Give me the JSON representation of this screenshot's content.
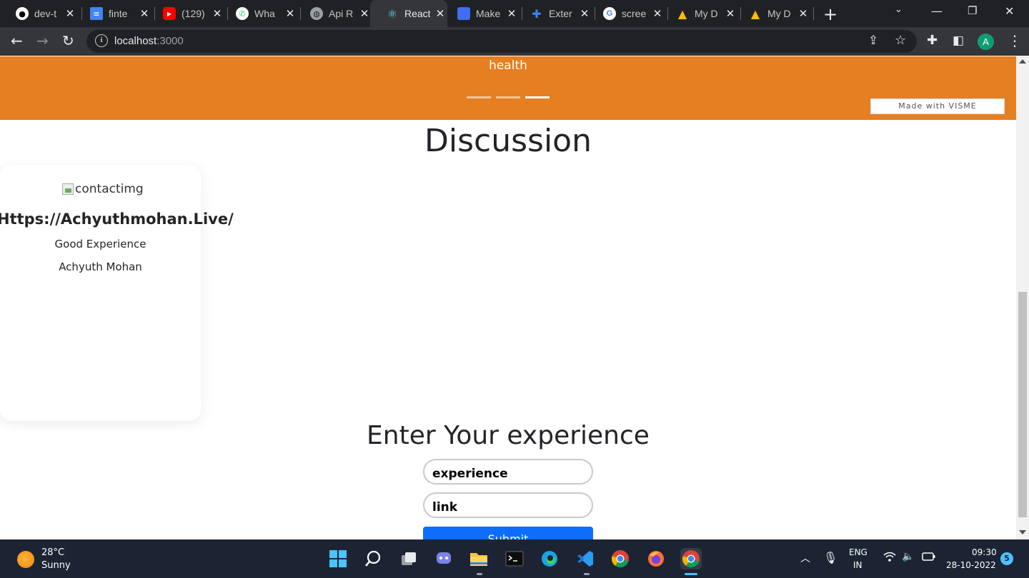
{
  "browser": {
    "tabs": [
      {
        "label": "dev-t",
        "icon": "github-icon",
        "color": "#ffffff"
      },
      {
        "label": "finte",
        "icon": "docs-icon",
        "color": "#4285f4"
      },
      {
        "label": "(129)",
        "icon": "youtube-icon",
        "color": "#ff0000"
      },
      {
        "label": "Wha",
        "icon": "whatsapp-icon",
        "color": "#25d366"
      },
      {
        "label": "Api R",
        "icon": "globe-icon",
        "color": "#9aa0a6"
      },
      {
        "label": "React",
        "icon": "react-icon",
        "color": "#61dafb",
        "active": true
      },
      {
        "label": "Make",
        "icon": "docs-blue-icon",
        "color": "#3f6ef3"
      },
      {
        "label": "Exter",
        "icon": "puzzle-icon",
        "color": "#3b82f6"
      },
      {
        "label": "scree",
        "icon": "google-icon",
        "color": "#ffffff"
      },
      {
        "label": "My D",
        "icon": "drive-icon",
        "color": "#fbbc04"
      },
      {
        "label": "My D",
        "icon": "drive-icon",
        "color": "#fbbc04"
      }
    ],
    "url_host": "localhost",
    "url_port": ":3000",
    "profile_initial": "A"
  },
  "banner": {
    "text": "health",
    "made_with": "Made with VISME",
    "active_slide": 3,
    "slide_count": 3
  },
  "discussion": {
    "heading": "Discussion",
    "cards": [
      {
        "img_alt": "contactimg",
        "link": "Https://Achyuthmohan.Live/",
        "experience": "Good Experience",
        "name": "Achyuth Mohan"
      }
    ]
  },
  "form": {
    "heading": "Enter Your experience",
    "experience_placeholder": "experience",
    "link_placeholder": "link",
    "submit_label": "Submit"
  },
  "taskbar": {
    "temperature": "28°C",
    "condition": "Sunny",
    "lang_1": "ENG",
    "lang_2": "IN",
    "time": "09:30",
    "date": "28-10-2022",
    "notification_count": "5"
  }
}
